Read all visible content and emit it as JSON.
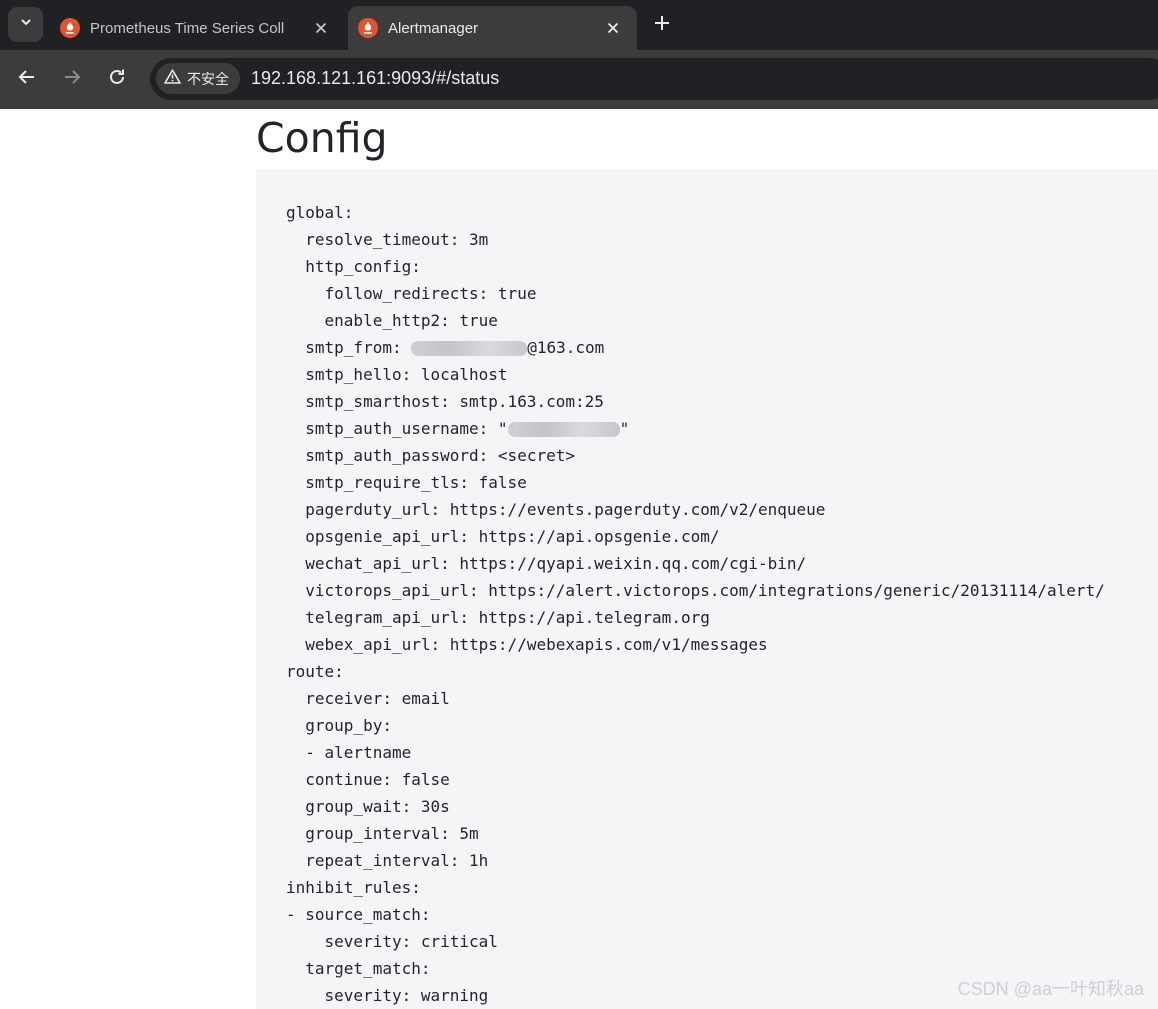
{
  "browser": {
    "tabs": [
      {
        "title": "Prometheus Time Series Coll",
        "icon": "prometheus-icon",
        "active": false
      },
      {
        "title": "Alertmanager",
        "icon": "prometheus-icon",
        "active": true
      }
    ],
    "security_label": "不安全",
    "url": "192.168.121.161:9093/#/status"
  },
  "page": {
    "title": "Config",
    "config_lines": [
      "global:",
      "  resolve_timeout: 3m",
      "  http_config:",
      "    follow_redirects: true",
      "    enable_http2: true",
      "  smtp_from: ",
      "@163.com",
      "  smtp_hello: localhost",
      "  smtp_smarthost: smtp.163.com:25",
      "  smtp_auth_username: \"",
      "\"",
      "  smtp_auth_password: <secret>",
      "  smtp_require_tls: false",
      "  pagerduty_url: https://events.pagerduty.com/v2/enqueue",
      "  opsgenie_api_url: https://api.opsgenie.com/",
      "  wechat_api_url: https://qyapi.weixin.qq.com/cgi-bin/",
      "  victorops_api_url: https://alert.victorops.com/integrations/generic/20131114/alert/",
      "  telegram_api_url: https://api.telegram.org",
      "  webex_api_url: https://webexapis.com/v1/messages",
      "route:",
      "  receiver: email",
      "  group_by:",
      "  - alertname",
      "  continue: false",
      "  group_wait: 30s",
      "  group_interval: 5m",
      "  repeat_interval: 1h",
      "inhibit_rules:",
      "- source_match:",
      "    severity: critical",
      "  target_match:",
      "    severity: warning"
    ]
  },
  "watermark": "CSDN @aa一叶知秋aa",
  "colors": {
    "tabstrip_bg": "#202124",
    "toolbar_bg": "#3c3c3c",
    "prometheus_orange": "#e6522c",
    "config_bg": "#f5f5f7"
  }
}
